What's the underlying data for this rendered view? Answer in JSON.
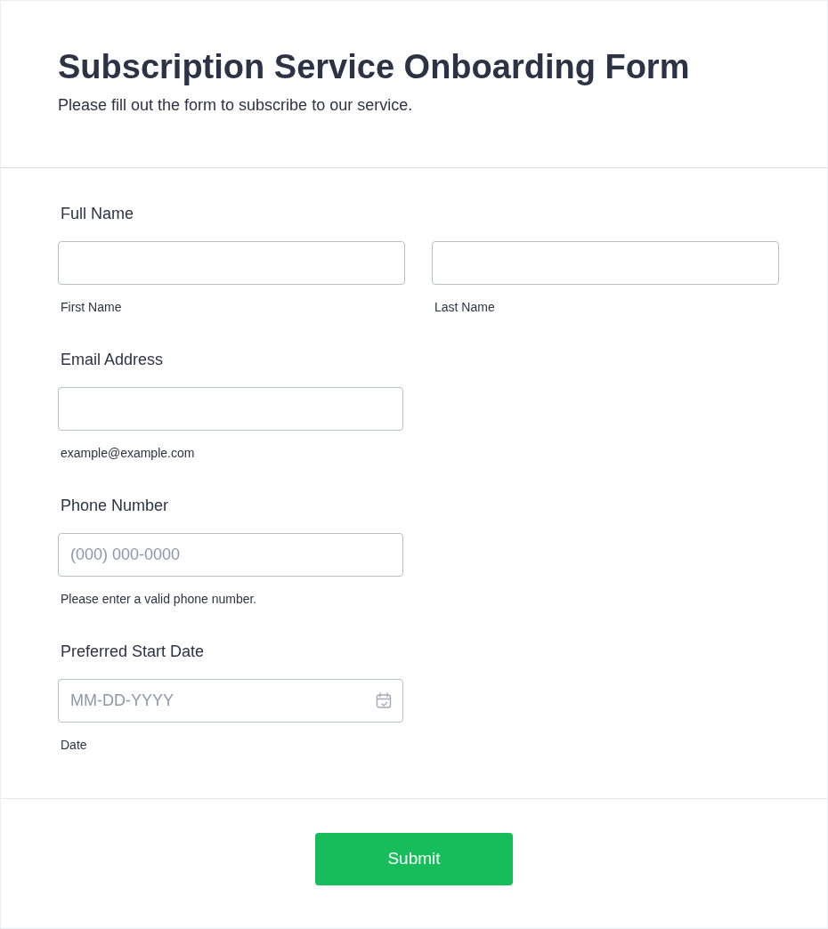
{
  "header": {
    "title": "Subscription Service Onboarding Form",
    "subtitle": "Please fill out the form to subscribe to our service."
  },
  "fields": [
    {
      "kind": "split",
      "label": "Full Name",
      "inputs": [
        {
          "sublabel": "First Name"
        },
        {
          "sublabel": "Last Name"
        }
      ]
    },
    {
      "kind": "text",
      "label": "Email Address",
      "sublabel": "example@example.com"
    },
    {
      "kind": "text",
      "label": "Phone Number",
      "placeholder": "(000) 000-0000",
      "sublabel": "Please enter a valid phone number."
    },
    {
      "kind": "date",
      "label": "Preferred Start Date",
      "placeholder": "MM-DD-YYYY",
      "sublabel": "Date"
    }
  ],
  "submit": {
    "label": "Submit"
  }
}
